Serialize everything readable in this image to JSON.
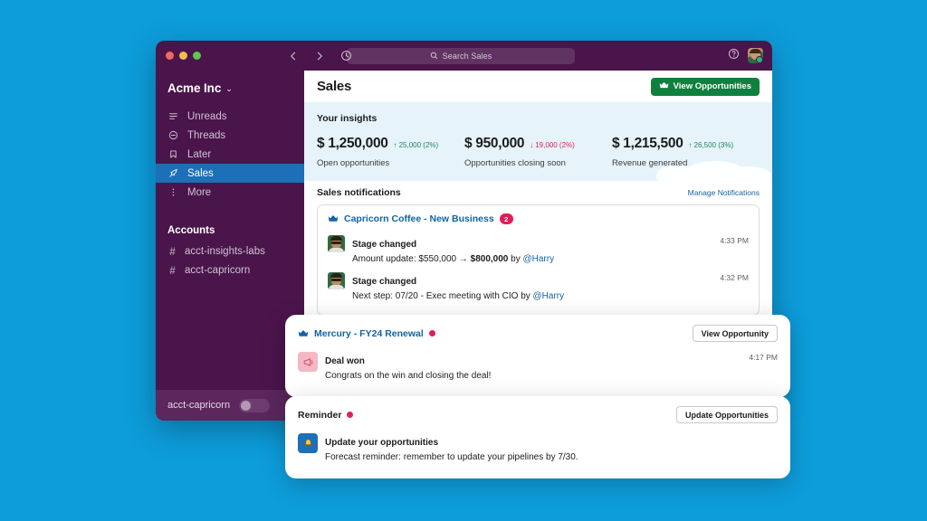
{
  "theme": {
    "page_background": "#0d9ddb",
    "sidebar_background": "#4a154b",
    "accent_blue": "#1264a3",
    "active_nav": "#1d6fb8",
    "green_button": "#10803f",
    "insights_background": "#e6f3fa",
    "badge_red": "#e01e5a",
    "positive_green": "#1c8a5a"
  },
  "titlebar": {
    "back_icon": "arrow-left-icon",
    "forward_icon": "arrow-right-icon",
    "history_icon": "clock-icon",
    "search_placeholder": "Search Sales",
    "search_icon": "search-icon",
    "help_icon": "help-circle-icon",
    "avatar": "user-avatar"
  },
  "sidebar": {
    "workspace": "Acme Inc",
    "workspace_chevron": "chevron-down-icon",
    "nav": [
      {
        "label": "Unreads",
        "icon": "unreads-icon",
        "active": false
      },
      {
        "label": "Threads",
        "icon": "threads-icon",
        "active": false
      },
      {
        "label": "Later",
        "icon": "bookmark-icon",
        "active": false
      },
      {
        "label": "Sales",
        "icon": "rocket-icon",
        "active": true
      },
      {
        "label": "More",
        "icon": "more-vertical-icon",
        "active": false
      }
    ],
    "section_title": "Accounts",
    "accounts": [
      {
        "label": "acct-insights-labs",
        "icon": "hash-icon"
      },
      {
        "label": "acct-capricorn",
        "icon": "hash-icon"
      }
    ],
    "footer": {
      "label": "acct-capricorn",
      "toggle_state": "off"
    }
  },
  "main": {
    "page_title": "Sales",
    "view_opportunities_button": "View Opportunities",
    "view_opportunities_icon": "crown-icon",
    "insights": {
      "title": "Your insights",
      "metrics": [
        {
          "amount": "$ 1,250,000",
          "delta": "25,000 (2%)",
          "direction": "up",
          "arrow": "▲",
          "label": "Open opportunities"
        },
        {
          "amount": "$ 950,000",
          "delta": "19,000 (2%)",
          "direction": "down",
          "arrow": "▼",
          "label": "Opportunities closing soon"
        },
        {
          "amount": "$ 1,215,500",
          "delta": "26,500 (3%)",
          "direction": "up",
          "arrow": "▲",
          "label": "Revenue generated"
        }
      ]
    },
    "notifications_header": {
      "title": "Sales notifications",
      "manage_link": "Manage Notifications"
    },
    "capricorn_card": {
      "icon": "crown-icon",
      "title": "Capricorn Coffee - New Business",
      "badge": "2",
      "rows": [
        {
          "avatar": "harry-avatar",
          "title": "Stage changed",
          "text_prefix": "Amount update: $550,000 → ",
          "text_bold": "$800,000",
          "text_mid": " by ",
          "mention": "@Harry",
          "time": "4:33 PM"
        },
        {
          "avatar": "harry-avatar",
          "title": "Stage changed",
          "text_prefix": "Next step: 07/20 - Exec meeting with CIO by ",
          "text_bold": "",
          "text_mid": "",
          "mention": "@Harry",
          "time": "4:32 PM"
        }
      ]
    }
  },
  "floating_cards": [
    {
      "id": "mercury",
      "icon": "crown-icon",
      "title": "Mercury - FY24 Renewal",
      "title_style": "blue",
      "status_dot": true,
      "action_button": "View Opportunity",
      "row": {
        "icon": "megaphone-icon",
        "icon_style": "pink",
        "title": "Deal won",
        "text": "Congrats on the win and closing the deal!",
        "time": "4:17 PM"
      }
    },
    {
      "id": "reminder",
      "icon": "",
      "title": "Reminder",
      "title_style": "dark",
      "status_dot": true,
      "action_button": "Update Opportunities",
      "row": {
        "icon": "bell-icon",
        "icon_style": "blue",
        "title": "Update your opportunities",
        "text": "Forecast reminder: remember to update your pipelines by 7/30.",
        "time": ""
      }
    }
  ]
}
